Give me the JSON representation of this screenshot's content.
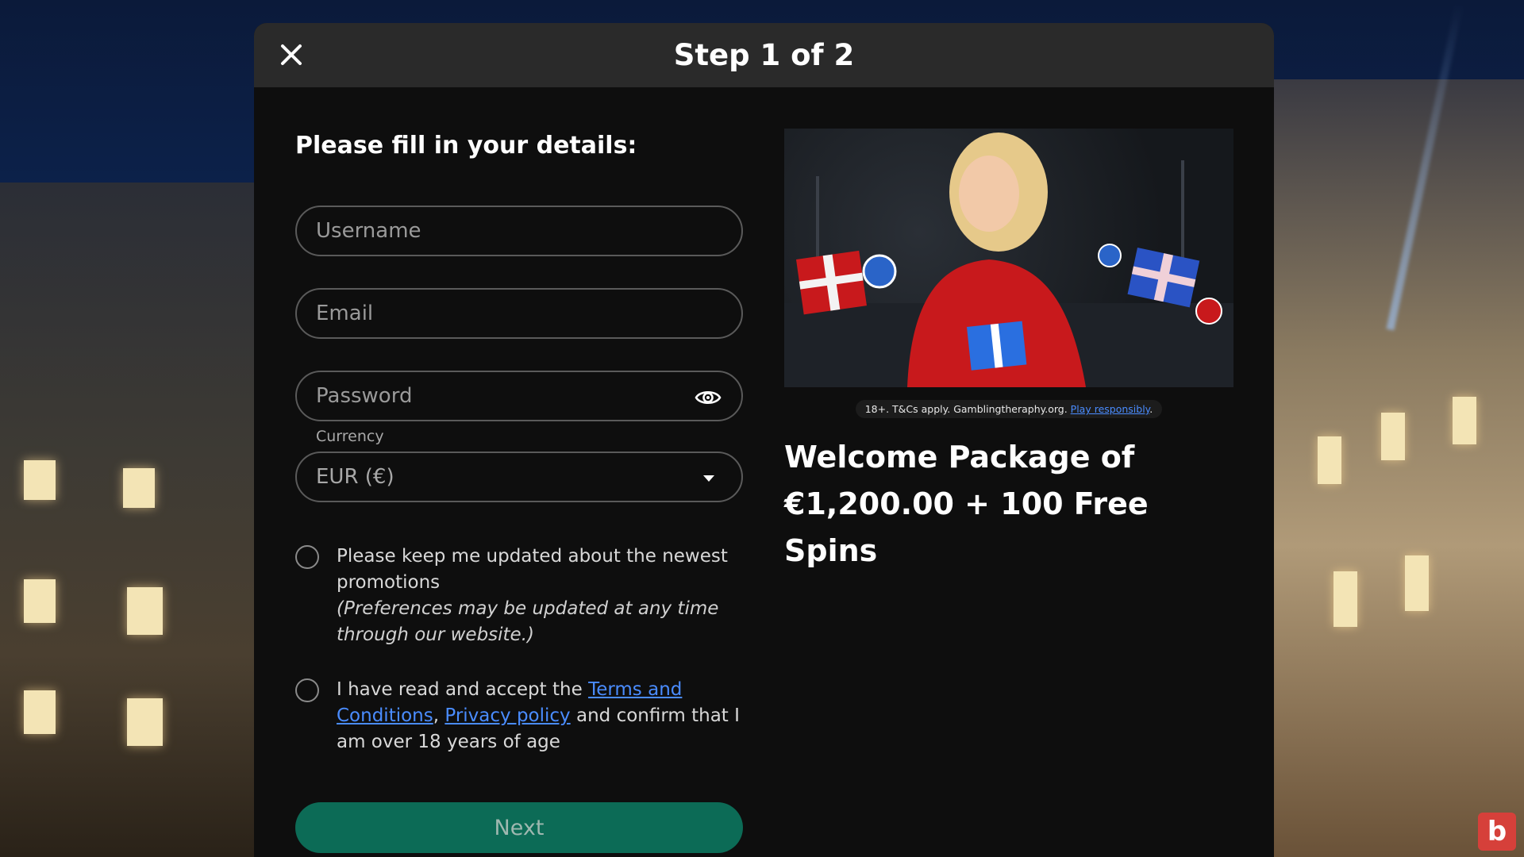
{
  "header": {
    "title": "Step 1 of 2"
  },
  "form": {
    "heading": "Please fill in your details:",
    "username_placeholder": "Username",
    "email_placeholder": "Email",
    "password_placeholder": "Password",
    "currency_label": "Currency",
    "currency_value": "EUR (€)",
    "promo_optin_text": "Please keep me updated about the newest promotions",
    "promo_optin_note": "(Preferences may be updated at any time through our website.)",
    "terms_prefix": "I have read and accept the ",
    "terms_link": "Terms and Conditions",
    "terms_sep": ", ",
    "privacy_link": "Privacy policy",
    "terms_suffix": " and confirm that I am over 18 years of age",
    "next_label": "Next"
  },
  "promo": {
    "disclaimer": "18+. T&Cs apply. Gamblingtheraphy.org. ",
    "disclaimer_link": "Play responsibly",
    "disclaimer_end": ".",
    "heading_line1": "Welcome Package of",
    "heading_line2": "€1,200.00 + 100 Free Spins"
  },
  "colors": {
    "accent_button": "#0c6b56",
    "link": "#4a8cff",
    "modal_bg": "#0e0e0e",
    "header_bg": "#2a2a2a"
  },
  "icons": {
    "close": "close-icon",
    "password_toggle": "eye-icon",
    "select_caret": "chevron-down-icon"
  }
}
